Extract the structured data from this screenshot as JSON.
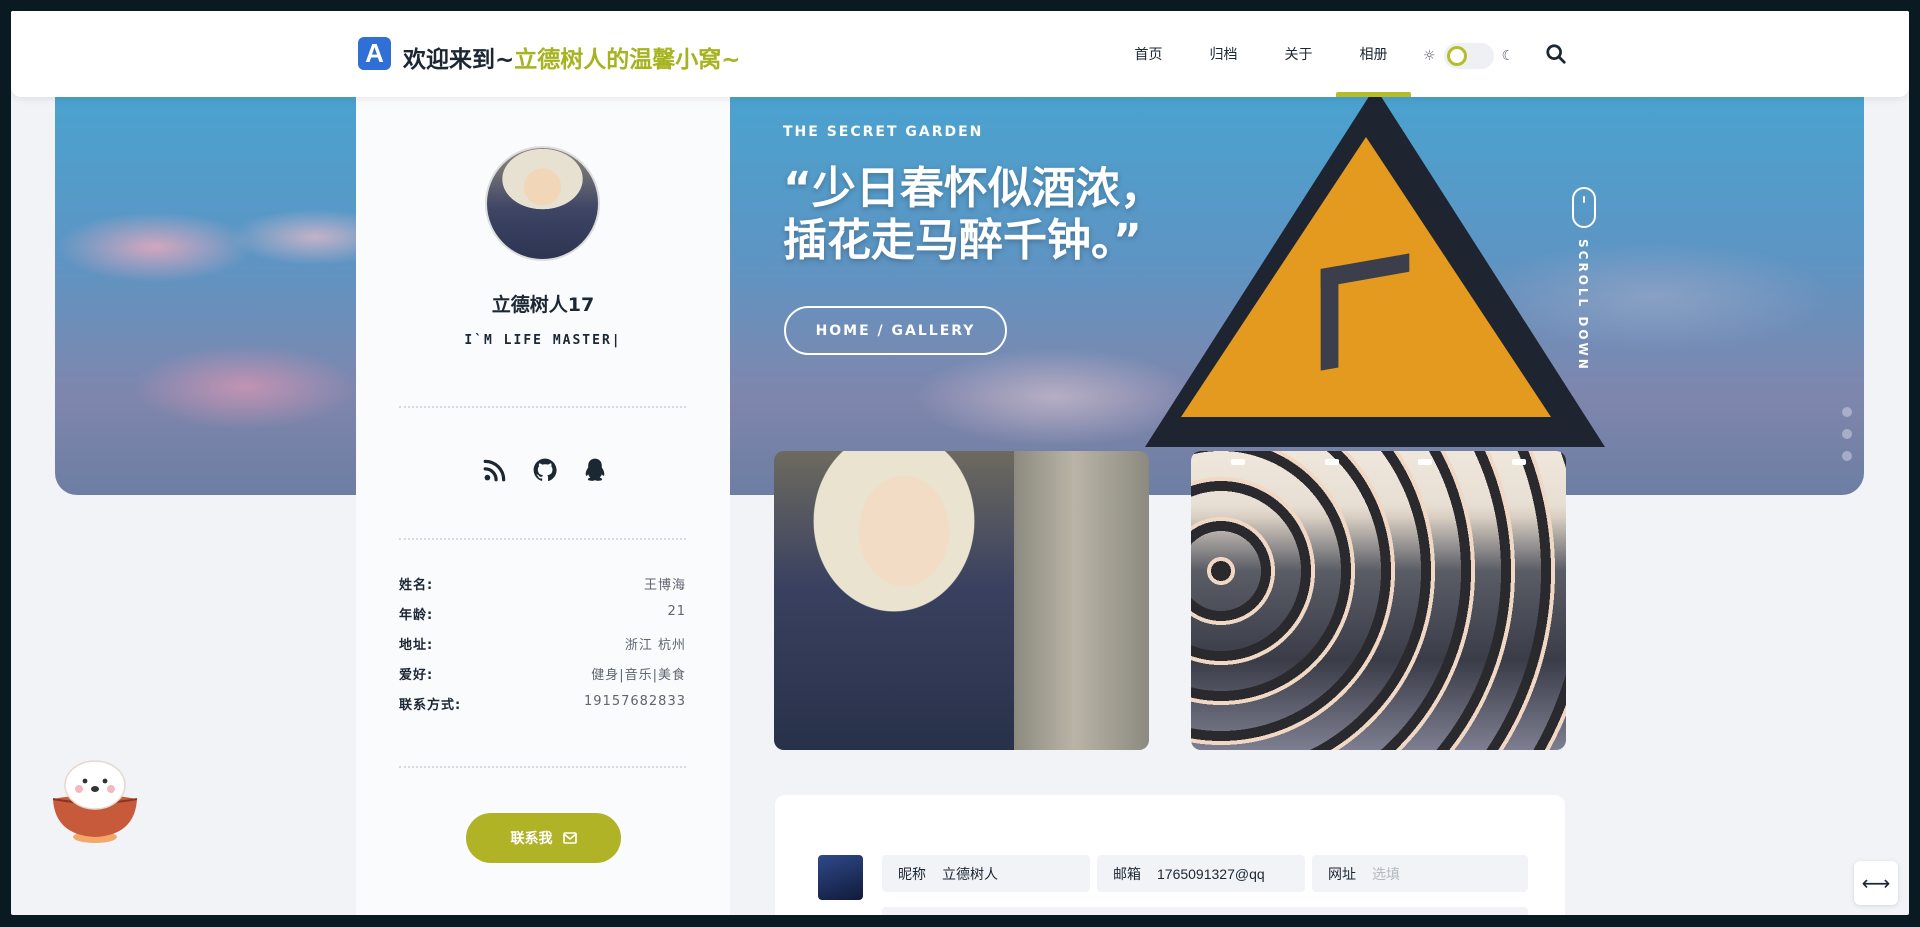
{
  "header": {
    "logo_letter": "A",
    "title_prefix": "欢迎来到~",
    "title_highlight": "立德树人的温馨小窝~",
    "nav": [
      {
        "label": "首页",
        "active": false
      },
      {
        "label": "归档",
        "active": false
      },
      {
        "label": "关于",
        "active": false
      },
      {
        "label": "相册",
        "active": true
      }
    ],
    "theme_toggle": "light",
    "accent_color": "#b5be2a"
  },
  "hero": {
    "kicker": "THE SECRET GARDEN",
    "quote_line1": "“少日春怀似酒浓，",
    "quote_line2": "插花走马醉千钟。”",
    "breadcrumb": "HOME /  GALLERY",
    "scroll_text": "SCROLL DOWN"
  },
  "profile": {
    "name": "立德树人17",
    "motto": "I`M LIFE MASTER|",
    "socials": [
      "rss-icon",
      "github-icon",
      "qq-icon"
    ],
    "info": [
      {
        "key": "姓名:",
        "value": "王博海"
      },
      {
        "key": "年龄:",
        "value": "21"
      },
      {
        "key": "地址:",
        "value": "浙江 杭州"
      },
      {
        "key": "爱好:",
        "value": "健身|音乐|美食"
      },
      {
        "key": "联系方式:",
        "value": "19157682833"
      }
    ],
    "contact_label": "联系我"
  },
  "gallery": [
    {
      "name": "portrait-photo"
    },
    {
      "name": "group-photo"
    }
  ],
  "comment_form": {
    "nickname_label": "昵称",
    "nickname_value": "立德树人",
    "email_label": "邮箱",
    "email_value": "1765091327@qq",
    "website_label": "网址",
    "website_placeholder": "选填"
  }
}
